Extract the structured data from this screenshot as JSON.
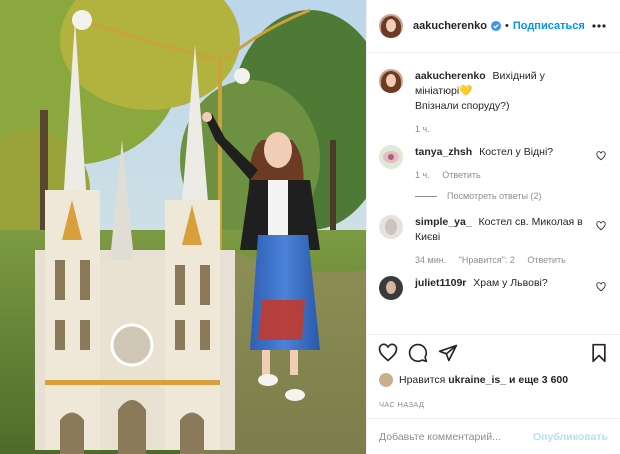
{
  "post": {
    "author": "aakucherenko",
    "follow_label": "Подписаться",
    "dot": "•",
    "caption": {
      "username": "aakucherenko",
      "line1": "Вихідний у",
      "line2": "мініатюрі💛",
      "line3": "Впізнали споруду?)",
      "time": "1 ч."
    },
    "comments": [
      {
        "username": "tanya_zhsh",
        "text": "Костел у Відні?",
        "time": "1 ч.",
        "reply_label": "Ответить",
        "view_replies": "Посмотреть ответы (2)"
      },
      {
        "username": "simple_ya_",
        "text": "Костел св. Миколая в Києві",
        "time": "34 мин.",
        "likes": "\"Нравится\": 2",
        "reply_label": "Ответить"
      },
      {
        "username": "juliet1109r",
        "text": "Храм у Львові?"
      }
    ],
    "likes": {
      "prefix": "Нравится",
      "user": "ukraine_is_",
      "suffix": "и еще 3 600"
    },
    "posted_ago": "ЧАС НАЗАД",
    "add_comment": {
      "placeholder": "Добавьте комментарий...",
      "publish_label": "Опубликовать"
    }
  },
  "icons": {
    "verified": "verified-badge-icon",
    "more": "more-horizontal-icon",
    "like": "heart-icon",
    "comment": "comment-bubble-icon",
    "share": "paper-plane-icon",
    "save": "bookmark-icon"
  },
  "colors": {
    "accent": "#0095f6",
    "publish_disabled": "#b2dffc",
    "muted": "#8e8e8e",
    "text": "#262626",
    "border": "#efefef"
  }
}
